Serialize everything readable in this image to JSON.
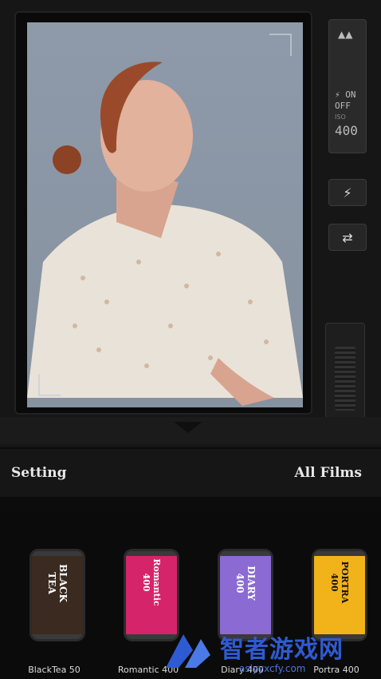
{
  "lcd": {
    "mode": "▲▲",
    "flash_line1": "⚡ ON",
    "flash_line2": "OFF",
    "iso_label": "ISO",
    "iso_value": "400"
  },
  "settings": {
    "left": "Setting",
    "right": "All Films"
  },
  "films": [
    {
      "name": "BlackTea 50",
      "label": "BLACK TEA",
      "color": "#3a2a20"
    },
    {
      "name": "Romantic 400",
      "label": "Romantic 400",
      "color": "#d6246a"
    },
    {
      "name": "Diary 400",
      "label": "DIARY 400",
      "color": "#8b6ad3"
    },
    {
      "name": "Portra 400",
      "label": "PORTRA 400",
      "color": "#f2b21a"
    }
  ],
  "watermark": {
    "text": "智者游戏网",
    "url": "aslyyxcfy.com"
  },
  "colors": {
    "accent": "#2e5bd2",
    "panel": "#161616"
  }
}
